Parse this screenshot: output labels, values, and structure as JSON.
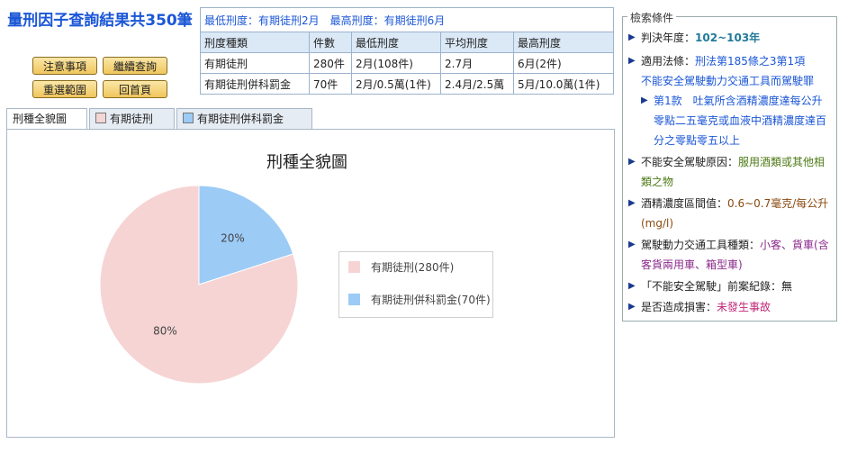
{
  "header": {
    "title": "量刑因子查詢結果共350筆"
  },
  "buttons": {
    "notes": "注意事項",
    "continue_query": "繼續查詢",
    "reselect_range": "重選範圍",
    "home": "回首頁"
  },
  "summary": {
    "caption": "最低刑度：有期徒刑2月　最高刑度：有期徒刑6月",
    "columns": [
      "刑度種類",
      "件數",
      "最低刑度",
      "平均刑度",
      "最高刑度"
    ],
    "rows": [
      [
        "有期徒刑",
        "280件",
        "2月(108件)",
        "2.7月",
        "6月(2件)"
      ],
      [
        "有期徒刑併科罰金",
        "70件",
        "2月/0.5萬(1件)",
        "2.4月/2.5萬",
        "5月/10.0萬(1件)"
      ]
    ]
  },
  "tabs": [
    {
      "label": "刑種全貌圖"
    },
    {
      "label": "有期徒刑",
      "color": "#f4d6d6"
    },
    {
      "label": "有期徒刑併科罰金",
      "color": "#9ccbf6"
    }
  ],
  "chart_data": {
    "type": "pie",
    "title": "刑種全貌圖",
    "series": [
      {
        "name": "有期徒刑(280件)",
        "value": 280,
        "percent_label": "80%",
        "color": "#f6d4d4"
      },
      {
        "name": "有期徒刑併科罰金(70件)",
        "value": 70,
        "percent_label": "20%",
        "color": "#9ccbf6"
      }
    ],
    "legend_position": "right"
  },
  "criteria": {
    "legend": "檢索條件",
    "items": [
      {
        "label": "判決年度：",
        "value": "102~103年",
        "value_color": "#1a56d6"
      },
      {
        "label": "適用法條：",
        "value": "刑法第185條之3第1項",
        "value_color": "#1a56d6",
        "extra": "不能安全駕駛動力交通工具而駕駛罪"
      },
      {
        "sub": true,
        "value": "第1款　吐氣所含酒精濃度達每公升零點二五毫克或血液中酒精濃度達百分之零點零五以上",
        "value_color": "#1a56d6"
      },
      {
        "label": "不能安全駕駛原因：",
        "value": "服用酒類或其他相類之物",
        "value_color": "#4c7a15"
      },
      {
        "label": "酒精濃度區間值：",
        "value": "0.6~0.7毫克/每公升(mg/l)",
        "value_color": "#8a4a12"
      },
      {
        "label": "駕駛動力交通工具種類：",
        "value": "小客、貨車(含客貨兩用車、箱型車)",
        "value_color": "#8a2a8a"
      },
      {
        "label": "「不能安全駕駛」前案紀錄：",
        "value": "無",
        "value_color": "#222"
      },
      {
        "label": "是否造成損害：",
        "value": "未發生事故",
        "value_color": "#c0287a"
      }
    ]
  }
}
